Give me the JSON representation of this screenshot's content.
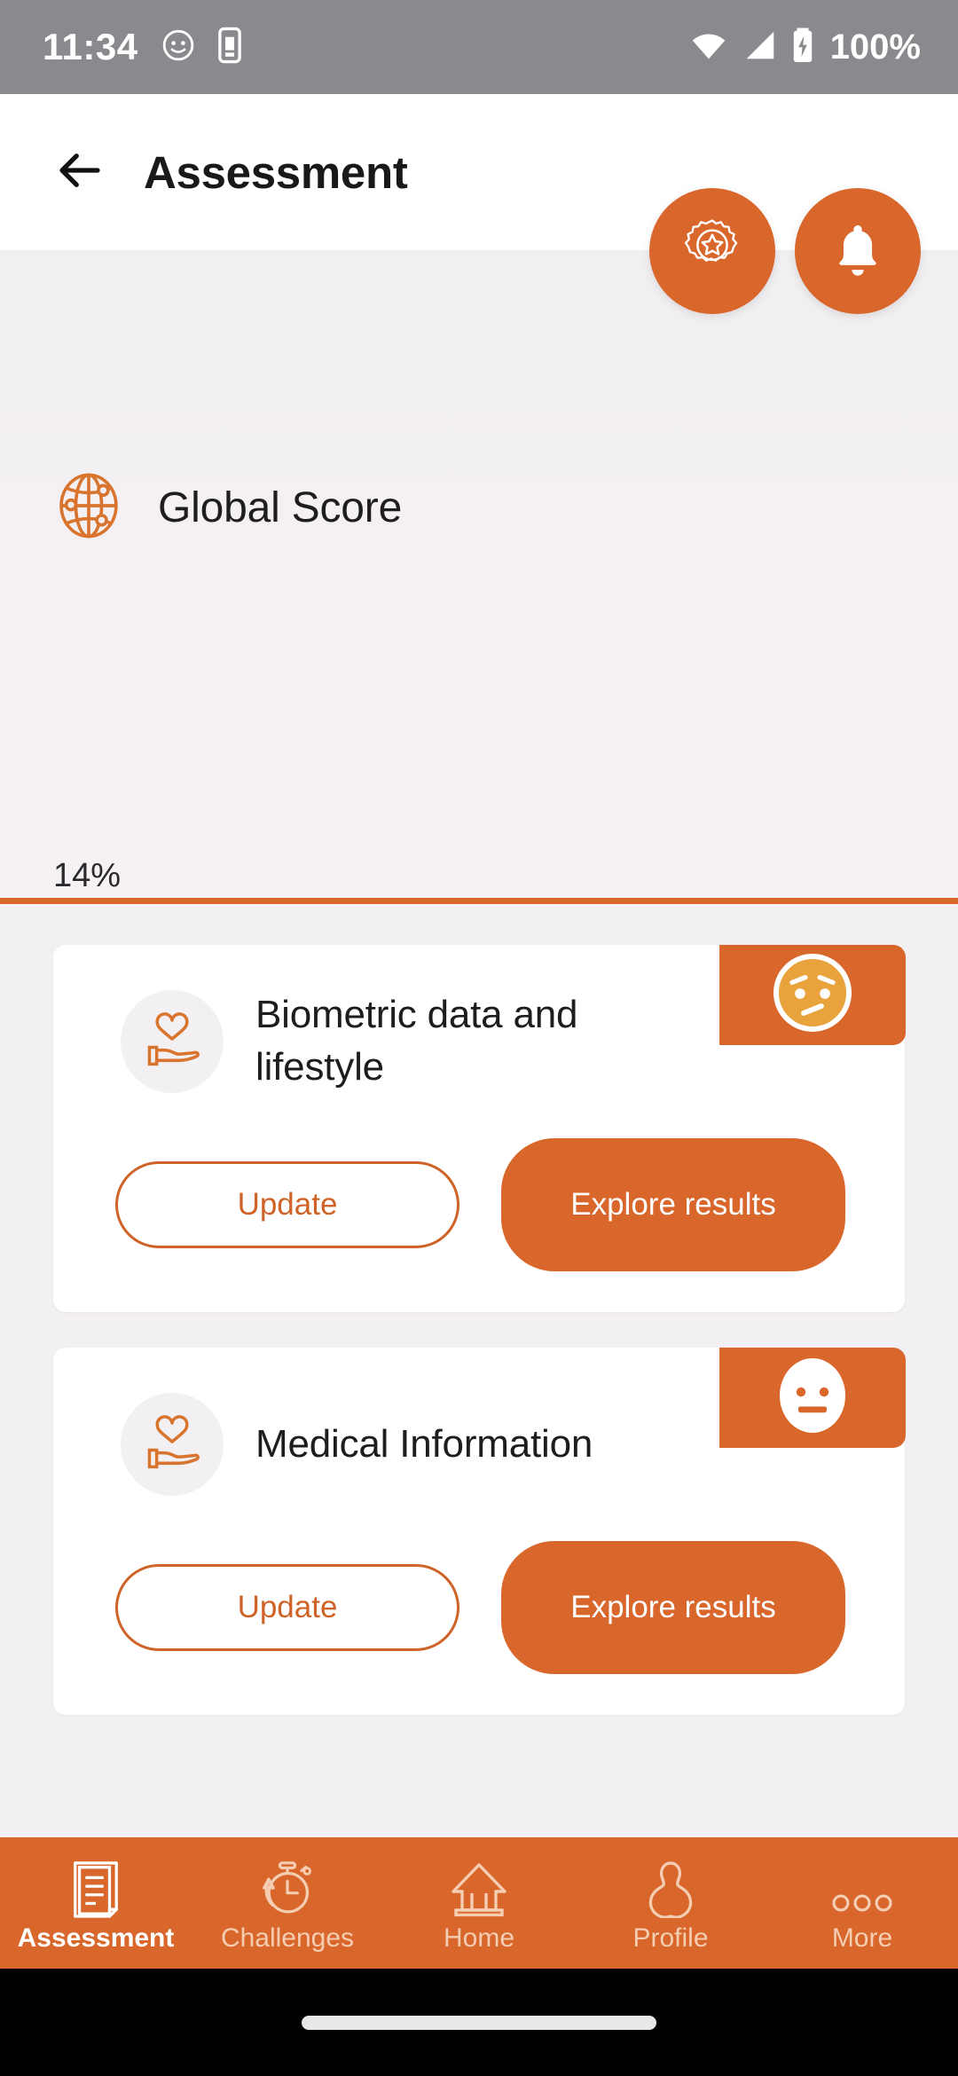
{
  "status_bar": {
    "time": "11:34",
    "battery_percent": "100%",
    "icons": [
      "face-icon",
      "sim-card-icon",
      "wifi-icon",
      "cellular-signal-icon",
      "battery-charging-icon"
    ]
  },
  "header": {
    "title": "Assessment",
    "back_icon": "arrow-left-icon",
    "accent_color": "#d9662a"
  },
  "fabs": [
    {
      "name": "badge-award-icon",
      "label": "Badge"
    },
    {
      "name": "bell-icon",
      "label": "Notifications"
    }
  ],
  "score": {
    "icon": "globe-icon",
    "title": "Global Score",
    "percent_label": "14%",
    "percent_value": 14,
    "history_icon": "history-clock-icon",
    "history_color": "#9f2b25",
    "track_color": "#e4e1e6",
    "fill_color": "#d9662a"
  },
  "cards": [
    {
      "icon": "heart-in-hand-icon",
      "title": "Biometric data and lifestyle",
      "emoji": "worried-face-icon",
      "emoji_color": "#e8a33d",
      "update_label": "Update",
      "explore_label": "Explore results"
    },
    {
      "icon": "heart-in-hand-icon",
      "title": "Medical Information",
      "emoji": "neutral-face-icon",
      "emoji_color": "#ffffff",
      "update_label": "Update",
      "explore_label": "Explore results"
    }
  ],
  "bottom_nav": {
    "items": [
      {
        "label": "Assessment",
        "icon": "document-icon",
        "active": true
      },
      {
        "label": "Challenges",
        "icon": "stopwatch-icon",
        "active": false
      },
      {
        "label": "Home",
        "icon": "house-icon",
        "active": false
      },
      {
        "label": "Profile",
        "icon": "person-icon",
        "active": false
      },
      {
        "label": "More",
        "icon": "more-dots-icon",
        "active": false
      }
    ],
    "background_color": "#d9662a",
    "active_color": "#ffffff",
    "inactive_color": "#f5cdb2"
  }
}
